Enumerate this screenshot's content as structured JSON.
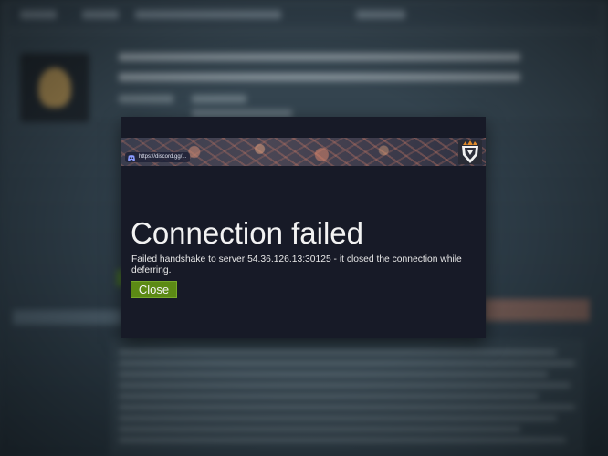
{
  "dialog": {
    "title": "Connection failed",
    "message": "Failed handshake to server 54.36.126.13:30125 - it closed the connection while deferring.",
    "close_label": "Close",
    "close_color": "#5c8a15",
    "background_color": "#171a27"
  },
  "banner": {
    "discord_invite": "https://discord.gg/...",
    "icons": [
      "discord-icon",
      "shield-emblem-icon"
    ]
  }
}
